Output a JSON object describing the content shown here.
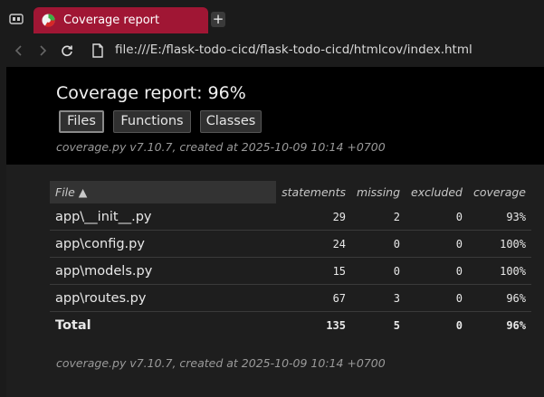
{
  "browser": {
    "tab_title": "Coverage report",
    "new_tab_label": "+",
    "url": "file:///E:/flask-todo-cicd/flask-todo-cicd/htmlcov/index.html"
  },
  "report": {
    "title": "Coverage report: 96%",
    "buttons": [
      "Files",
      "Functions",
      "Classes"
    ],
    "meta": "coverage.py v7.10.7, created at 2025-10-09 10:14 +0700",
    "columns": [
      "File ▲",
      "statements",
      "missing",
      "excluded",
      "coverage"
    ],
    "rows": [
      {
        "file": "app\\__init__.py",
        "statements": "29",
        "missing": "2",
        "excluded": "0",
        "coverage": "93%"
      },
      {
        "file": "app\\config.py",
        "statements": "24",
        "missing": "0",
        "excluded": "0",
        "coverage": "100%"
      },
      {
        "file": "app\\models.py",
        "statements": "15",
        "missing": "0",
        "excluded": "0",
        "coverage": "100%"
      },
      {
        "file": "app\\routes.py",
        "statements": "67",
        "missing": "3",
        "excluded": "0",
        "coverage": "96%"
      }
    ],
    "total": {
      "file": "Total",
      "statements": "135",
      "missing": "5",
      "excluded": "0",
      "coverage": "96%"
    },
    "footer_meta": "coverage.py v7.10.7, created at 2025-10-09 10:14 +0700"
  }
}
